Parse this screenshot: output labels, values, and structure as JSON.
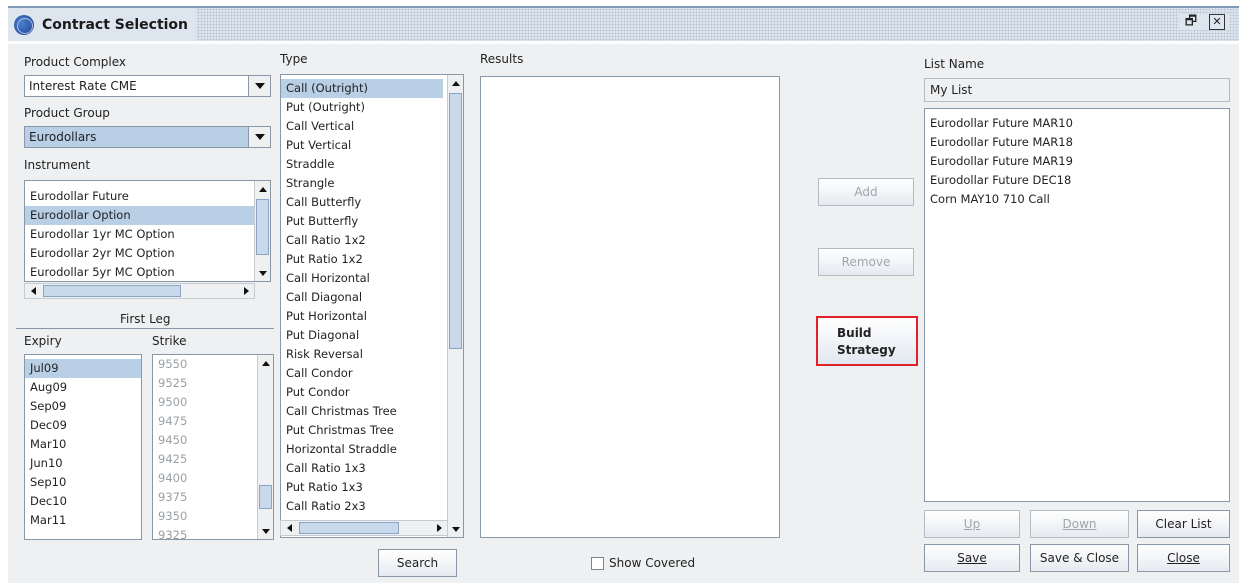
{
  "window": {
    "title": "Contract Selection"
  },
  "labels": {
    "product_complex": "Product Complex",
    "product_group": "Product Group",
    "instrument": "Instrument",
    "first_leg": "First Leg",
    "expiry": "Expiry",
    "strike": "Strike",
    "type": "Type",
    "results": "Results",
    "list_name": "List Name"
  },
  "product_complex": {
    "value": "Interest Rate CME"
  },
  "product_group": {
    "value": "Eurodollars"
  },
  "instruments": [
    "Eurodollar Future",
    "Eurodollar Option",
    "Eurodollar 1yr MC Option",
    "Eurodollar 2yr MC Option",
    "Eurodollar 5yr MC Option"
  ],
  "instrument_selected": "Eurodollar Option",
  "expiries": [
    "Jul09",
    "Aug09",
    "Sep09",
    "Dec09",
    "Mar10",
    "Jun10",
    "Sep10",
    "Dec10",
    "Mar11"
  ],
  "expiry_selected": "Jul09",
  "strikes": [
    "9550",
    "9525",
    "9500",
    "9475",
    "9450",
    "9425",
    "9400",
    "9375",
    "9350",
    "9325"
  ],
  "types": [
    "Call (Outright)",
    "Put (Outright)",
    "Call Vertical",
    "Put Vertical",
    "Straddle",
    "Strangle",
    "Call Butterfly",
    "Put Butterfly",
    "Call Ratio 1x2",
    "Put Ratio 1x2",
    "Call Horizontal",
    "Call Diagonal",
    "Put Horizontal",
    "Put Diagonal",
    "Risk Reversal",
    "Call Condor",
    "Put Condor",
    "Call Christmas Tree",
    "Put Christmas Tree",
    "Horizontal Straddle",
    "Call Ratio 1x3",
    "Put Ratio 1x3",
    "Call Ratio 2x3"
  ],
  "type_selected": "Call (Outright)",
  "buttons": {
    "search": "Search",
    "add": "Add",
    "remove": "Remove",
    "build_line1": "Build",
    "build_line2": "Strategy",
    "up": "Up",
    "down": "Down",
    "clear_list": "Clear List",
    "save": "Save",
    "save_close": "Save & Close",
    "close": "Close"
  },
  "show_covered": {
    "label": "Show Covered",
    "checked": false
  },
  "list_name": {
    "value": "My List"
  },
  "list_items": [
    "Eurodollar Future MAR10",
    "Eurodollar Future MAR18",
    "Eurodollar Future MAR19",
    "Eurodollar Future DEC18",
    "Corn MAY10 710 Call"
  ],
  "colors": {
    "selection": "#b8cfe5",
    "highlight_border": "#e0212a",
    "panel": "#eef0f2"
  }
}
